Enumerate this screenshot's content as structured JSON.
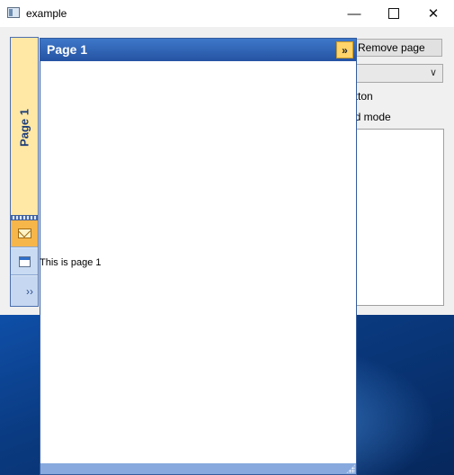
{
  "window": {
    "title": "example",
    "minimize_glyph": "—",
    "close_glyph": "✕"
  },
  "controls": {
    "remove_page_label": "Remove page",
    "combo_value": "",
    "button_label_partial": "utton",
    "mode_label_partial": "ed mode"
  },
  "sidebar": {
    "active_page_label": "Page 1",
    "buttons": [
      {
        "icon": "mail-icon"
      },
      {
        "icon": "calendar-icon"
      },
      {
        "icon": "more-options-icon",
        "glyph": "››"
      }
    ]
  },
  "panel": {
    "title": "Page 1",
    "collapse_glyph": "»",
    "content_text": "This is page 1"
  }
}
